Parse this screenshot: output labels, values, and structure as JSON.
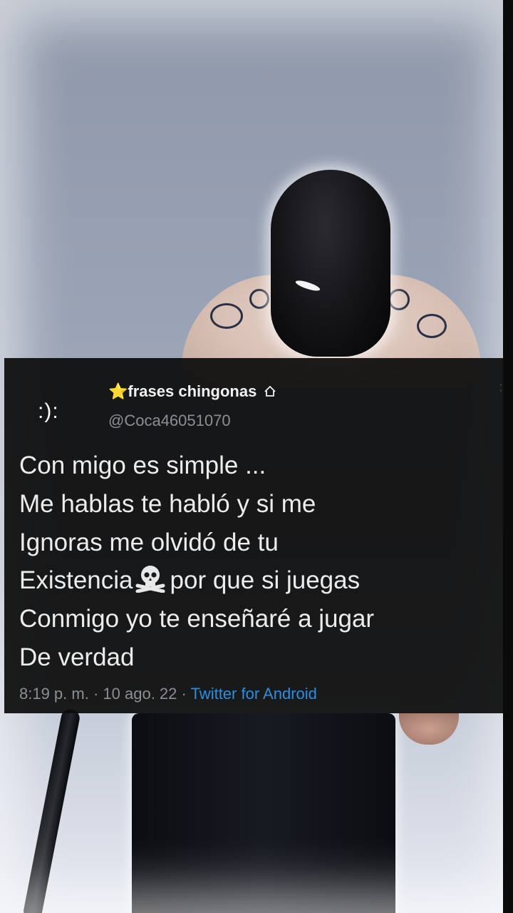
{
  "tweet": {
    "avatar_text": ":):",
    "display_name": "⭐frases chingonas",
    "display_name_icon": "house-outline-icon",
    "handle": "@Coca46051070",
    "body_lines": [
      "Con migo es simple ...",
      "Me hablas te habló y si me",
      "Ignoras me olvidó de tu",
      "Existencia",
      "por que si juegas",
      "Conmigo yo te enseñaré a jugar",
      "De verdad"
    ],
    "skull_icon": "skull-crossbones-icon",
    "time": "8:19 p. m.",
    "separator": "·",
    "date": "10 ago. 22",
    "source": "Twitter for Android"
  },
  "colors": {
    "card_bg": "#0c0c0c",
    "text": "#ececec",
    "muted": "#8b8f95",
    "link": "#2a8fe0"
  }
}
